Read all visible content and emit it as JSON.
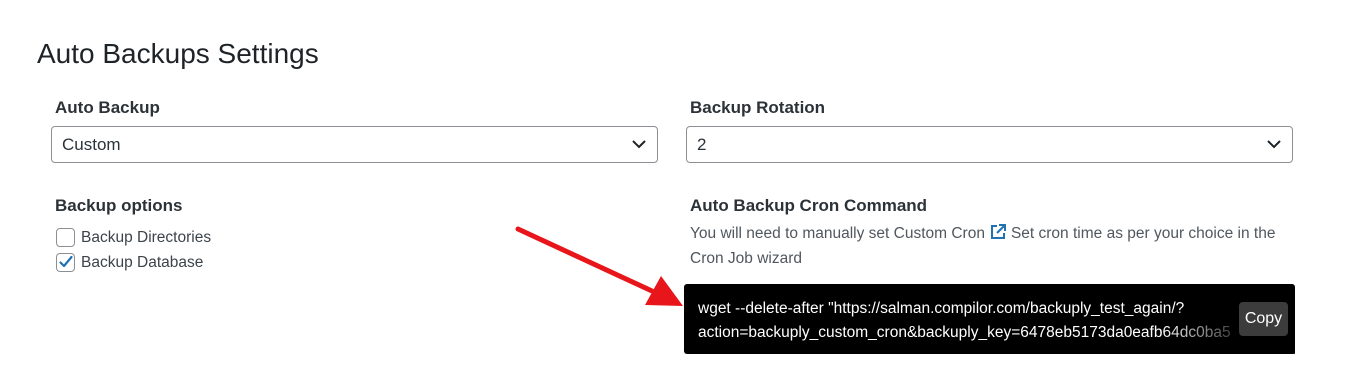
{
  "page": {
    "title": "Auto Backups Settings"
  },
  "auto_backup": {
    "label": "Auto Backup",
    "selected": "Custom"
  },
  "backup_rotation": {
    "label": "Backup Rotation",
    "selected": "2"
  },
  "backup_options": {
    "label": "Backup options",
    "items": [
      {
        "label": "Backup Directories",
        "checked": false
      },
      {
        "label": "Backup Database",
        "checked": true
      }
    ]
  },
  "cron": {
    "label": "Auto Backup Cron Command",
    "desc_before": "You will need to manually set Custom Cron",
    "desc_after": "Set cron time as per your choice in the Cron Job wizard",
    "command_line1": "wget --delete-after \"https://salman.compilor.com/backuply_test_again/?",
    "command_line2": "action=backuply_custom_cron&backuply_key=6478eb5173da0eafb64dc0ba5",
    "copy_label": "Copy"
  },
  "colors": {
    "annotation_arrow": "#e8161a",
    "checkbox_accent": "#2271b1",
    "link_icon": "#2271b1"
  }
}
